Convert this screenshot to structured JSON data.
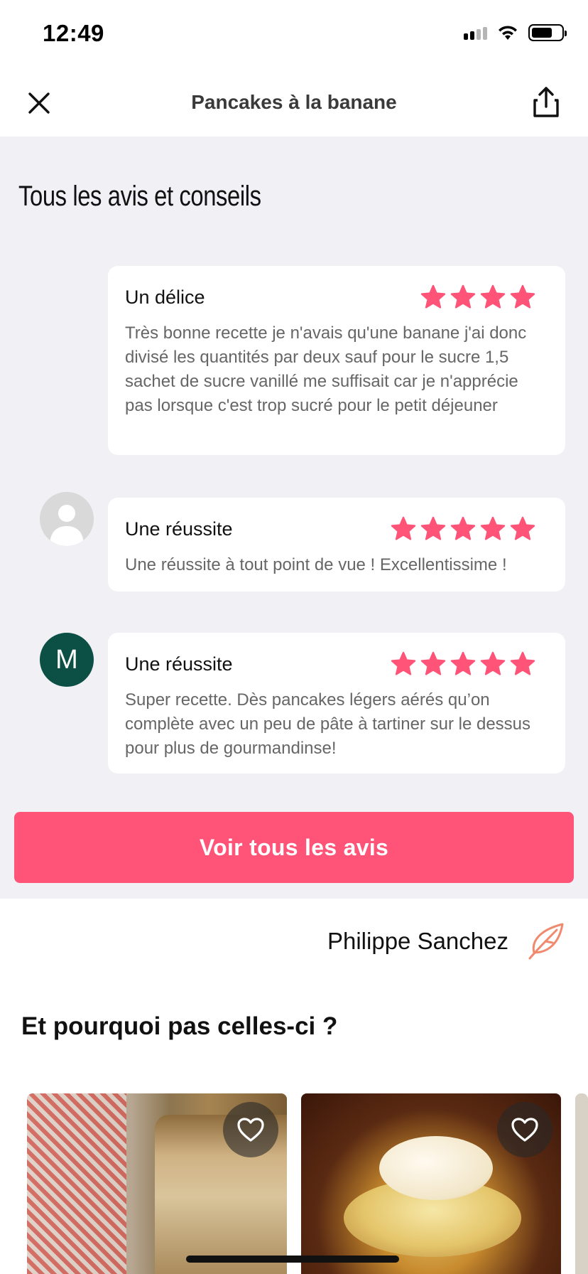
{
  "status_bar": {
    "time": "12:49"
  },
  "nav": {
    "title": "Pancakes à la banane"
  },
  "reviews_section": {
    "title": "Tous les avis et conseils",
    "reviews": [
      {
        "title": "Un délice",
        "rating": 4,
        "text": "Très bonne recette  je n'avais qu'une banane j'ai donc divisé les quantités par deux sauf pour le sucre 1,5 sachet de sucre vanillé me suffisait car je n'apprécie pas lorsque c'est trop sucré pour le petit déjeuner",
        "avatar": "none"
      },
      {
        "title": "Une réussite",
        "rating": 5,
        "text": "Une réussite à tout point de vue ! Excellentissime !",
        "avatar": "placeholder"
      },
      {
        "title": "Une réussite",
        "rating": 5,
        "text": "Super recette. Dès pancakes légers aérés qu’on complète avec un peu de pâte à tartiner sur le dessus pour plus de gourmandinse!",
        "avatar": "letter",
        "avatar_letter": "M"
      }
    ],
    "cta_label": "Voir tous les avis"
  },
  "author": {
    "name": "Philippe Sanchez",
    "icon": "feather-icon"
  },
  "suggestions": {
    "title": "Et pourquoi pas celles-ci ?",
    "cards": [
      {
        "image": "banana-bread-photo",
        "favorite_icon": "heart-outline-icon"
      },
      {
        "image": "caramelized-banana-photo",
        "favorite_icon": "heart-outline-icon"
      }
    ]
  },
  "colors": {
    "accent": "#ff5378",
    "star": "#ff5378",
    "avatar_bg": "#0c4f44",
    "section_bg": "#f1f1f5",
    "feather": "#f08a6e"
  }
}
